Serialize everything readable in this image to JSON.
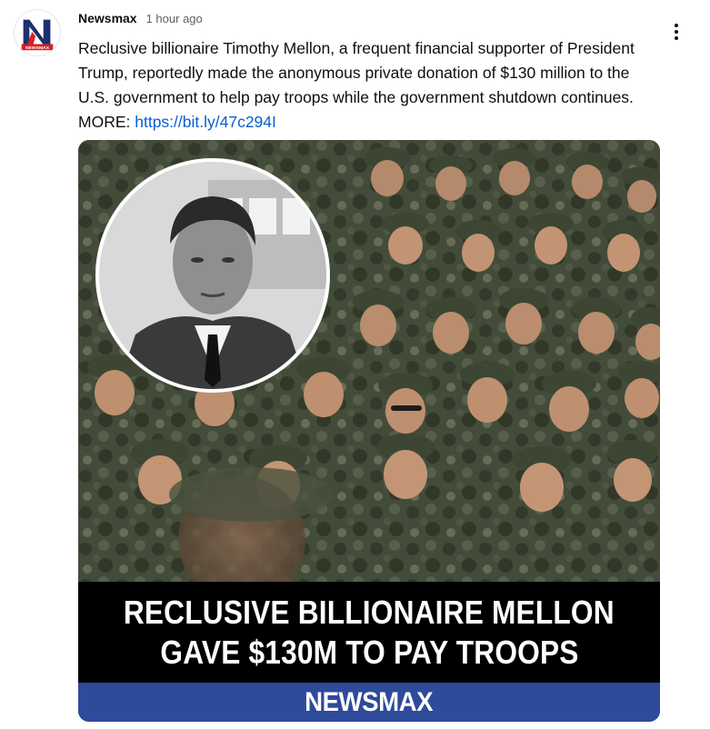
{
  "post": {
    "author": "Newsmax",
    "time": "1 hour ago",
    "avatar_text": "NEWSMAX",
    "text": "Reclusive billionaire Timothy Mellon, a frequent financial supporter of President Trump, reportedly made the anonymous private donation of $130 million to the U.S. government to help pay troops while the government shutdown continues. MORE: ",
    "link": "https://bit.ly/47c294I",
    "menu_icon": "more-vert-icon"
  },
  "image": {
    "headline_line1": "RECLUSIVE BILLIONAIRE MELLON",
    "headline_line2": "GAVE $130M TO PAY TROOPS",
    "brand": "NEWSMAX"
  },
  "colors": {
    "link": "#065fd4",
    "brand_bar": "#2e4a9a",
    "headline_bg": "#000000",
    "avatar_red": "#d71f26",
    "avatar_navy": "#1c2f6f"
  }
}
